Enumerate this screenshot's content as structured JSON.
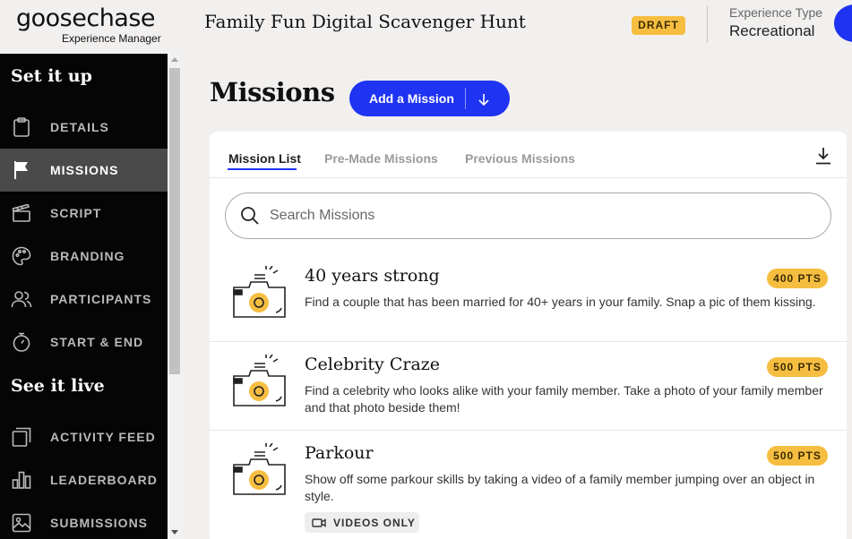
{
  "header": {
    "logo_text": "goosechase",
    "logo_sub": "Experience Manager",
    "hunt_title": "Family Fun Digital Scavenger Hunt",
    "status_badge": "DRAFT",
    "experience_type_label": "Experience Type",
    "experience_type_value": "Recreational"
  },
  "sidebar": {
    "sections": [
      {
        "title": "Set it up",
        "items": [
          {
            "label": "DETAILS",
            "icon": "clipboard-icon",
            "active": false
          },
          {
            "label": "MISSIONS",
            "icon": "flag-icon",
            "active": true
          },
          {
            "label": "SCRIPT",
            "icon": "clapperboard-icon",
            "active": false
          },
          {
            "label": "BRANDING",
            "icon": "palette-icon",
            "active": false
          },
          {
            "label": "PARTICIPANTS",
            "icon": "people-icon",
            "active": false
          },
          {
            "label": "START & END",
            "icon": "stopwatch-icon",
            "active": false
          }
        ]
      },
      {
        "title": "See it live",
        "items": [
          {
            "label": "ACTIVITY FEED",
            "icon": "feed-icon",
            "active": false
          },
          {
            "label": "LEADERBOARD",
            "icon": "bar-chart-icon",
            "active": false
          },
          {
            "label": "SUBMISSIONS",
            "icon": "image-icon",
            "active": false
          }
        ]
      }
    ]
  },
  "main": {
    "title": "Missions",
    "add_button": "Add a Mission",
    "tabs": [
      {
        "label": "Mission List",
        "active": true
      },
      {
        "label": "Pre-Made Missions",
        "active": false
      },
      {
        "label": "Previous Missions",
        "active": false
      }
    ],
    "search": {
      "placeholder": "Search Missions",
      "value": ""
    },
    "missions": [
      {
        "title": "40 years strong",
        "description": "Find a couple that has been married for 40+ years in your family. Snap a pic of them kissing.",
        "points": "400 PTS",
        "media_tag": ""
      },
      {
        "title": "Celebrity Craze",
        "description": "Find a celebrity who looks alike with your family member. Take a photo of your family member and that photo beside them!",
        "points": "500 PTS",
        "media_tag": ""
      },
      {
        "title": "Parkour",
        "description": "Show off some parkour skills by taking a video of a family member jumping over an object in style.",
        "points": "500 PTS",
        "media_tag": "VIDEOS ONLY"
      }
    ]
  },
  "colors": {
    "brand_blue": "#1f33f2",
    "badge_yellow": "#f6be41",
    "sidebar_bg": "#050505",
    "sidebar_active": "#4a4a4a",
    "page_bg": "#f2f0ef"
  }
}
